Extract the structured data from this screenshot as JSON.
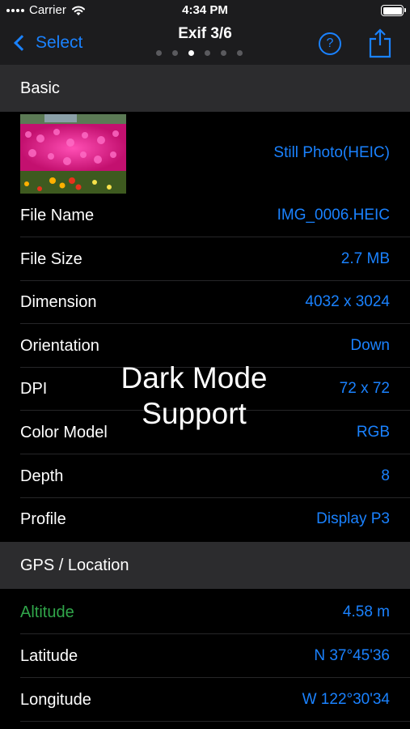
{
  "status_bar": {
    "carrier": "Carrier",
    "time": "4:34 PM"
  },
  "nav": {
    "back_label": "Select",
    "title": "Exif 3/6",
    "help_label": "?",
    "page_count": 6,
    "active_page": 3
  },
  "sections": {
    "basic": {
      "title": "Basic",
      "thumbnail_value": "Still Photo(HEIC)",
      "rows": [
        {
          "label": "File Name",
          "value": "IMG_0006.HEIC"
        },
        {
          "label": "File Size",
          "value": "2.7 MB"
        },
        {
          "label": "Dimension",
          "value": "4032 x 3024"
        },
        {
          "label": "Orientation",
          "value": "Down"
        },
        {
          "label": "DPI",
          "value": "72 x 72"
        },
        {
          "label": "Color Model",
          "value": "RGB"
        },
        {
          "label": "Depth",
          "value": "8"
        },
        {
          "label": "Profile",
          "value": "Display P3"
        }
      ]
    },
    "gps": {
      "title": "GPS / Location",
      "rows": [
        {
          "label": "Altitude",
          "value": "4.58 m"
        },
        {
          "label": "Latitude",
          "value": "N 37°45'36"
        },
        {
          "label": "Longitude",
          "value": "W 122°30'34"
        }
      ]
    }
  },
  "overlay": {
    "line1": "Dark Mode",
    "line2": "Support"
  },
  "colors": {
    "accent": "#1a82ff",
    "altitude_label": "#30a64a",
    "background": "#000000",
    "section_bg": "#2c2c2e"
  }
}
